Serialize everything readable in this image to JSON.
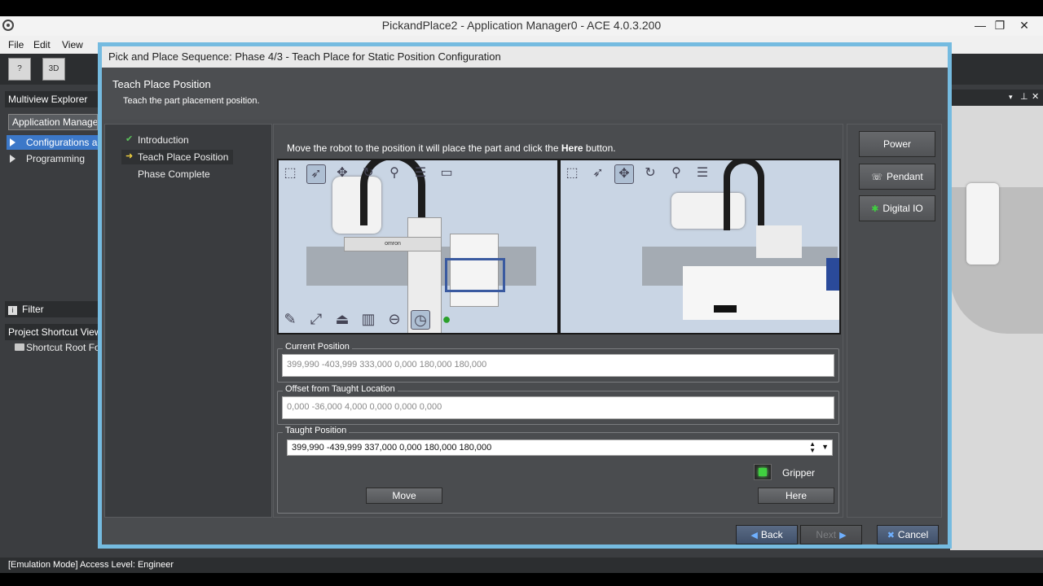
{
  "app": {
    "title": "PickandPlace2 - Application Manager0 - ACE 4.0.3.200",
    "minimize": "—",
    "restore": "❐",
    "close": "✕"
  },
  "menu": {
    "file": "File",
    "edit": "Edit",
    "view": "View"
  },
  "toolbar": {
    "help_label": "?",
    "view3d_label": "3D"
  },
  "explorer": {
    "title": "Multiview Explorer",
    "tab": "Application Manager",
    "items": [
      "Configurations and Setup",
      "Programming"
    ],
    "filter": "Filter",
    "shortcut_title": "Project Shortcut View",
    "shortcut_root": "Shortcut Root Folder"
  },
  "wizard": {
    "title": "Pick and Place Sequence: Phase 4/3 - Teach Place for Static Position Configuration",
    "header": "Teach Place Position",
    "subheader": "Teach the part placement position.",
    "steps": [
      "Introduction",
      "Teach Place Position",
      "Phase Complete"
    ],
    "instruction_pre": "Move the robot to the position it will place the part and click the",
    "instruction_bold": "Here",
    "instruction_post": "button.",
    "current_position_label": "Current Position",
    "current_position": "399,990 -403,999 333,000 0,000 180,000 180,000",
    "offset_label": "Offset from Taught Location",
    "offset": "0,000 -36,000 4,000 0,000 0,000 0,000",
    "taught_label": "Taught Position",
    "taught": "399,990 -439,999 337,000 0,000 180,000 180,000",
    "gripper_label": "Gripper",
    "move_label": "Move",
    "here_label": "Here",
    "power_label": "Power",
    "pendant_label": "Pendant",
    "digital_io_label": "Digital IO",
    "back_label": "Back",
    "next_label": "Next",
    "cancel_label": "Cancel",
    "robot_label": "omron"
  },
  "status": {
    "text": "[Emulation Mode] Access Level: Engineer"
  },
  "colors": {
    "accent": "#75bbe0",
    "selection": "#3c78c8",
    "gripper_on": "#40d040"
  }
}
